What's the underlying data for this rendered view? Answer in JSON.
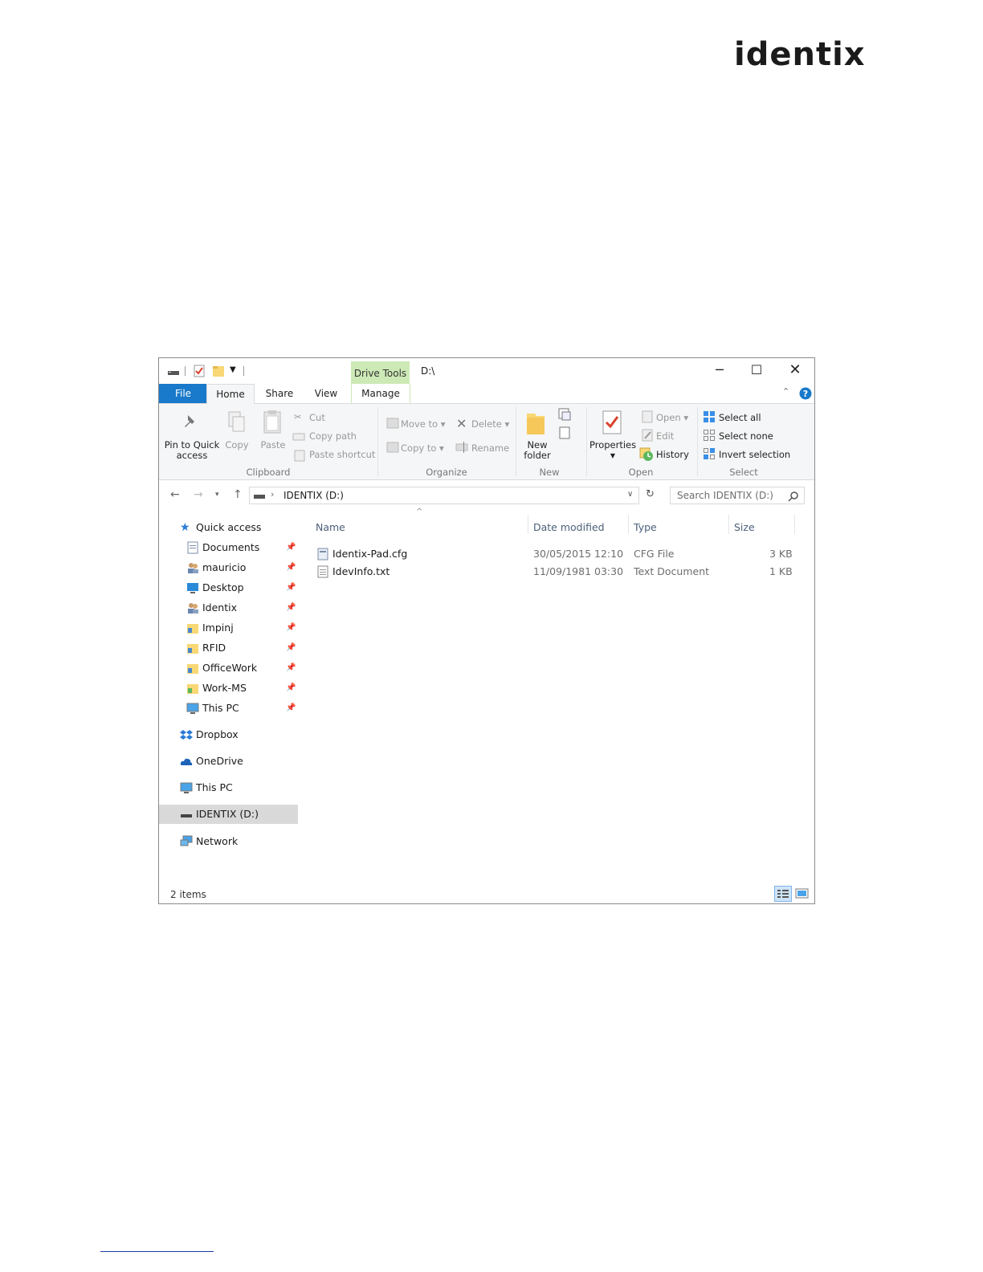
{
  "logo": {
    "text": "identix"
  },
  "window": {
    "title": "D:\\",
    "context_tab_group": "Drive Tools",
    "tabs": [
      "File",
      "Home",
      "Share",
      "View",
      "Manage"
    ],
    "active_tab": "Home"
  },
  "ribbon": {
    "clipboard": {
      "label": "Clipboard",
      "pin": "Pin to Quick",
      "pin2": "access",
      "copy": "Copy",
      "paste": "Paste",
      "cut": "Cut",
      "copy_path": "Copy path",
      "paste_shortcut": "Paste shortcut"
    },
    "organize": {
      "label": "Organize",
      "move_to": "Move to",
      "copy_to": "Copy to",
      "delete": "Delete",
      "rename": "Rename"
    },
    "new": {
      "label": "New",
      "new_folder": "New",
      "new_folder2": "folder"
    },
    "open": {
      "label": "Open",
      "properties": "Properties",
      "open": "Open",
      "edit": "Edit",
      "history": "History"
    },
    "select": {
      "label": "Select",
      "select_all": "Select all",
      "select_none": "Select none",
      "invert": "Invert selection"
    }
  },
  "address": {
    "path": "IDENTIX (D:)",
    "search_placeholder": "Search IDENTIX (D:)"
  },
  "nav": {
    "quick_access": "Quick access",
    "pinned": [
      "Documents",
      "mauricio",
      "Desktop",
      "Identix",
      "Impinj",
      "RFID",
      "OfficeWork",
      "Work-MS",
      "This PC"
    ],
    "dropbox": "Dropbox",
    "onedrive": "OneDrive",
    "this_pc": "This PC",
    "drive": "IDENTIX (D:)",
    "network": "Network"
  },
  "columns": [
    "Name",
    "Date modified",
    "Type",
    "Size"
  ],
  "files": [
    {
      "name": "Identix-Pad.cfg",
      "date": "30/05/2015 12:10",
      "type": "CFG File",
      "size": "3 KB"
    },
    {
      "name": "IdevInfo.txt",
      "date": "11/09/1981 03:30",
      "type": "Text Document",
      "size": "1 KB"
    }
  ],
  "status": {
    "items": "2 items"
  },
  "colors": {
    "file_tab": "#1979ca",
    "drive_tools": "#cde9b5",
    "selected": "#d9d9d9"
  }
}
